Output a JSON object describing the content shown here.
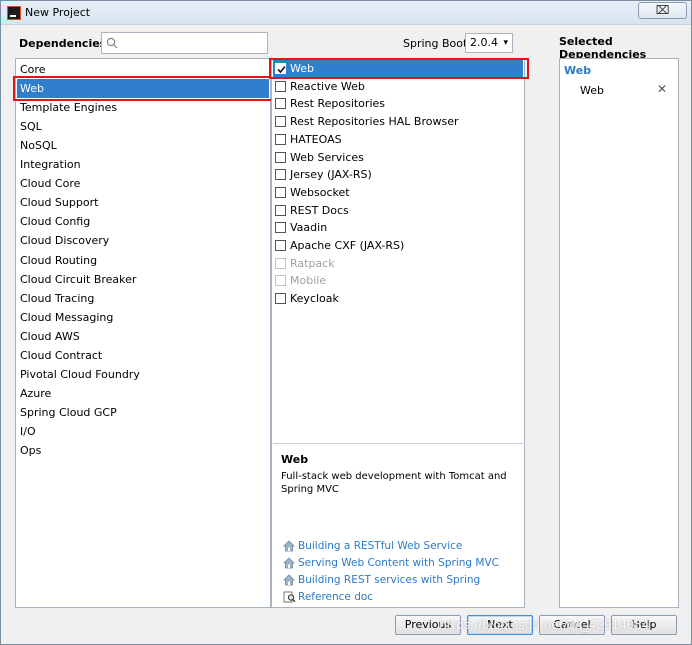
{
  "window": {
    "title": "New Project",
    "close_symbol": "⌧"
  },
  "toolbar": {
    "dependencies_label": "Dependencies",
    "search_value": "",
    "boot_label": "Spring Boot",
    "boot_version": "2.0.4",
    "selected_label": "Selected Dependencies"
  },
  "categories": [
    "Core",
    "Web",
    "Template Engines",
    "SQL",
    "NoSQL",
    "Integration",
    "Cloud Core",
    "Cloud Support",
    "Cloud Config",
    "Cloud Discovery",
    "Cloud Routing",
    "Cloud Circuit Breaker",
    "Cloud Tracing",
    "Cloud Messaging",
    "Cloud AWS",
    "Cloud Contract",
    "Pivotal Cloud Foundry",
    "Azure",
    "Spring Cloud GCP",
    "I/O",
    "Ops"
  ],
  "selected_category": "Web",
  "dependencies": [
    {
      "label": "Web",
      "checked": true,
      "enabled": true,
      "selected": true
    },
    {
      "label": "Reactive Web",
      "checked": false,
      "enabled": true
    },
    {
      "label": "Rest Repositories",
      "checked": false,
      "enabled": true
    },
    {
      "label": "Rest Repositories HAL Browser",
      "checked": false,
      "enabled": true
    },
    {
      "label": "HATEOAS",
      "checked": false,
      "enabled": true
    },
    {
      "label": "Web Services",
      "checked": false,
      "enabled": true
    },
    {
      "label": "Jersey (JAX-RS)",
      "checked": false,
      "enabled": true
    },
    {
      "label": "Websocket",
      "checked": false,
      "enabled": true
    },
    {
      "label": "REST Docs",
      "checked": false,
      "enabled": true
    },
    {
      "label": "Vaadin",
      "checked": false,
      "enabled": true
    },
    {
      "label": "Apache CXF (JAX-RS)",
      "checked": false,
      "enabled": true
    },
    {
      "label": "Ratpack",
      "checked": false,
      "enabled": false
    },
    {
      "label": "Mobile",
      "checked": false,
      "enabled": false
    },
    {
      "label": "Keycloak",
      "checked": false,
      "enabled": true
    }
  ],
  "description": {
    "title": "Web",
    "text": "Full-stack web development with Tomcat and Spring MVC",
    "links": [
      {
        "label": "Building a RESTful Web Service",
        "icon": "home-icon"
      },
      {
        "label": "Serving Web Content with Spring MVC",
        "icon": "home-icon"
      },
      {
        "label": "Building REST services with Spring",
        "icon": "home-icon"
      },
      {
        "label": "Reference doc",
        "icon": "doc-search-icon"
      }
    ]
  },
  "selected": {
    "group": "Web",
    "items": [
      {
        "label": "Web",
        "remove": "✕"
      }
    ]
  },
  "buttons": {
    "previous": "Previous",
    "next": "Next",
    "cancel": "Cancel",
    "help": "Help"
  },
  "watermark": "https://blog.csdn.net/qq_42914054",
  "colors": {
    "selection": "#2f7fcc",
    "link": "#2a7ac9",
    "highlight_box": "#e0141c"
  }
}
